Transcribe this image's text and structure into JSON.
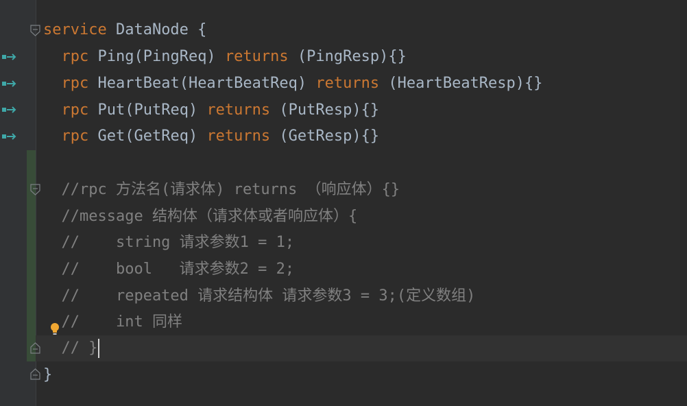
{
  "editor": {
    "language": "protobuf",
    "colors": {
      "background": "#2b2b2b",
      "gutter": "#313335",
      "keyword": "#cc7832",
      "comment": "#808080",
      "text": "#a9b7c6",
      "current_line": "#323232",
      "changed_lines_marker": "#384c38",
      "implemented_marker": "#3fa8a8",
      "bulb": "#f0a732"
    },
    "gutter_icons": {
      "implemented": "implemented-arrow-icon",
      "fold_open": "fold-open-icon",
      "fold_close": "fold-close-icon",
      "intention": "lightbulb-icon"
    },
    "lines": {
      "l1": {
        "kw": "service",
        "rest": " DataNode {"
      },
      "l2": {
        "indent": "  ",
        "kw1": "rpc",
        "mid": " Ping(PingReq) ",
        "kw2": "returns",
        "rest": " (PingResp){}"
      },
      "l3": {
        "indent": "  ",
        "kw1": "rpc",
        "mid": " HeartBeat(HeartBeatReq) ",
        "kw2": "returns",
        "rest": " (HeartBeatResp){}"
      },
      "l4": {
        "indent": "  ",
        "kw1": "rpc",
        "mid": " Put(PutReq) ",
        "kw2": "returns",
        "rest": " (PutResp){}"
      },
      "l5": {
        "indent": "  ",
        "kw1": "rpc",
        "mid": " Get(GetReq) ",
        "kw2": "returns",
        "rest": " (GetResp){}"
      },
      "l6": {
        "text": ""
      },
      "l7": {
        "text": "  //rpc 方法名(请求体) returns （响应体）{}"
      },
      "l8": {
        "text": "  //message 结构体（请求体或者响应体）{"
      },
      "l9": {
        "text": "  //    string 请求参数1 = 1;"
      },
      "l10": {
        "text": "  //    bool   请求参数2 = 2;"
      },
      "l11": {
        "text": "  //    repeated 请求结构体 请求参数3 = 3;(定义数组)"
      },
      "l12": {
        "text": "  //    int 同样"
      },
      "l13": {
        "text": "  // }"
      },
      "l14": {
        "text": "}"
      }
    }
  }
}
